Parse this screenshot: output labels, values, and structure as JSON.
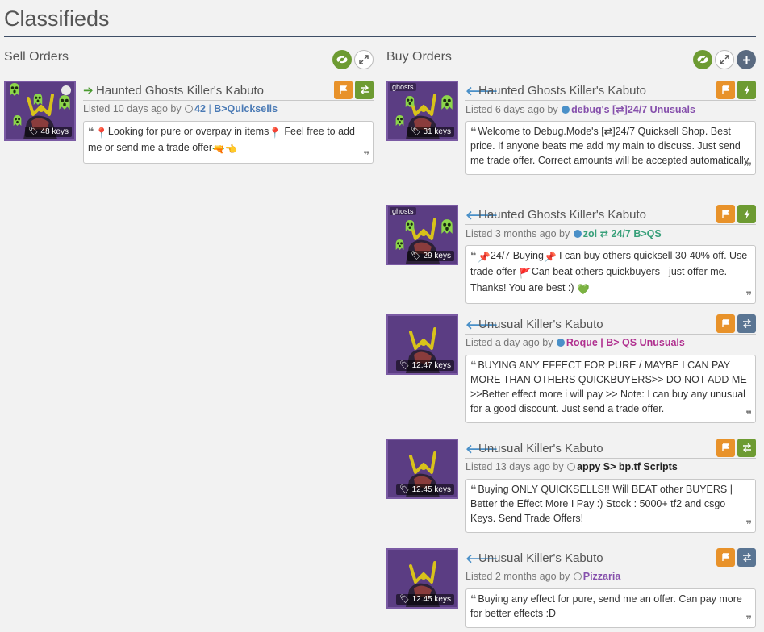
{
  "page": {
    "title": "Classifieds"
  },
  "sell": {
    "title": "Sell Orders",
    "listings": [
      {
        "item_name": "Haunted Ghosts Killer's Kabuto",
        "price": "48 keys",
        "listed": "Listed 10 days ago by",
        "user_number": "42",
        "user_sep": "|",
        "user_name": "B>Quicksells",
        "user_color": "#4a7ab5",
        "comment_a": "Looking for pure or overpay in items",
        "comment_b": "Feel free to add me or send me a trade offer"
      }
    ]
  },
  "buy": {
    "title": "Buy Orders",
    "listings": [
      {
        "item_name": "Haunted Ghosts Killer's Kabuto",
        "price": "31 keys",
        "badge": "ghosts",
        "listed": "Listed 6 days ago by",
        "user_name": "debug's [⇄]24/7 Unusuals",
        "user_color": "#8650ac",
        "comment": "Welcome to Debug.Mode's [⇄]24/7 Quicksell Shop. Best price. If anyone beats me add my main to discuss. Just send me trade offer. Correct amounts will be accepted automatically."
      },
      {
        "item_name": "Haunted Ghosts Killer's Kabuto",
        "price": "29 keys",
        "badge": "ghosts",
        "listed": "Listed 3 months ago by",
        "user_name": "zol ⇄ 24/7 B>QS",
        "user_color": "#38a07a",
        "comment_a": "24/7 Buying",
        "comment_b": "I can buy others quicksell 30-40% off. Use trade offer",
        "comment_c": "Can beat others quickbuyers - just offer me. Thanks! You are best :)"
      },
      {
        "item_name": "Unusual Killer's Kabuto",
        "price": "12.47 keys",
        "listed": "Listed a day ago by",
        "user_name": "Roque | B> QS Unusuals",
        "user_color": "#b0308f",
        "comment": "BUYING ANY EFFECT FOR PURE / MAYBE I CAN PAY MORE THAN OTHERS QUICKBUYERS>> DO NOT ADD ME >>Better effect more i will pay >> Note: I can buy any unusual for a good discount. Just send a trade offer."
      },
      {
        "item_name": "Unusual Killer's Kabuto",
        "price": "12.45 keys",
        "listed": "Listed 13 days ago by",
        "user_name": "appy S> bp.tf Scripts",
        "user_color": "#222222",
        "comment": "Buying ONLY QUICKSELLS!! Will BEAT other BUYERS | Better the Effect More I Pay :) Stock : 5000+ tf2 and csgo Keys. Send Trade Offers!"
      },
      {
        "item_name": "Unusual Killer's Kabuto",
        "price": "12.45 keys",
        "listed": "Listed 2 months ago by",
        "user_name": "Pizzaria",
        "user_color": "#8650ac",
        "comment": "Buying any effect for pure, send me an offer. Can pay more for better effects :D"
      }
    ]
  },
  "icons": {
    "eye": "eye-icon",
    "expand": "expand-icon",
    "add": "plus-icon",
    "flag": "flag-icon",
    "trade": "trade-icon",
    "bolt": "bolt-icon",
    "quote_open": "❝",
    "quote_close": "❞",
    "arrow_sell": "➔",
    "arrow_buy": "🡐"
  },
  "colors": {
    "accent_green": "#6d9b32",
    "accent_orange": "#e8922a",
    "thumb_bg": "#5b3d83",
    "rule": "#3e4e66",
    "arrow_buy": "#4a90c8"
  }
}
